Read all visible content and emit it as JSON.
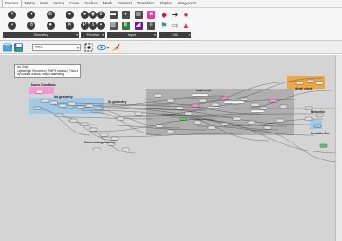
{
  "menu": {
    "tabs": [
      "Params",
      "Maths",
      "Sets",
      "Vector",
      "Curve",
      "Surface",
      "Mesh",
      "Intersect",
      "Transform",
      "Display",
      "Kangaroo2"
    ],
    "active_tab": "Params"
  },
  "ribbon": {
    "groups": [
      {
        "label": "Geometry",
        "icons": [
          "circle-x-icon",
          "circle-node-icon",
          "circle-slash-icon",
          "circle-node-icon",
          "circle-check-icon",
          "circle-slash-icon",
          "circle-node-icon",
          "circle-x-icon"
        ]
      },
      {
        "label": "Primitive",
        "icons": [
          "circle-node-icon",
          "circle-data-icon",
          "circle-d-icon",
          "circle-p-icon",
          "circle-s-icon",
          "circle-node-icon"
        ]
      },
      {
        "label": "Input",
        "icons": [
          "slider-icon",
          "toggle-icon",
          "panel-icon",
          "swatch-icon",
          "gradient-icon",
          "param-icon",
          "graph-icon",
          "value-list-icon"
        ]
      },
      {
        "label": "Util",
        "icons": [
          "palette-icon",
          "arrow-right-icon",
          "cherry-icon",
          "flag-icon",
          "arrow-outline-icon",
          "warning-icon"
        ]
      }
    ]
  },
  "toolbar": {
    "zoom": "70%"
  },
  "canvas": {
    "info_panel": {
      "line1": "Ivo Cha1",
      "line2": "Lightweight Structures | RWP3 Kassian | Tricia & Bol",
      "line3": "by Ananta Grand & Stepki Batenberg"
    },
    "group_labels": {
      "source_condition": "Source Condition",
      "init_geometry": "Init geometry",
      "gl_geometry": "GL geometry",
      "goal_graph": "Goal mesh",
      "angle_check": "Angle check",
      "connection_geometry": "Connection geometry",
      "brace_list": "Brace list",
      "result": "Result to Geo"
    }
  },
  "colors": {
    "canvas_bg": "#d4d4d4",
    "group_blue": "#9cc8e6",
    "group_gray": "#a8a8a8",
    "group_orange": "#f0a43a",
    "group_pink": "#ff8fd8",
    "group_green": "#5dc95d",
    "wire": "#1b1b1b"
  }
}
